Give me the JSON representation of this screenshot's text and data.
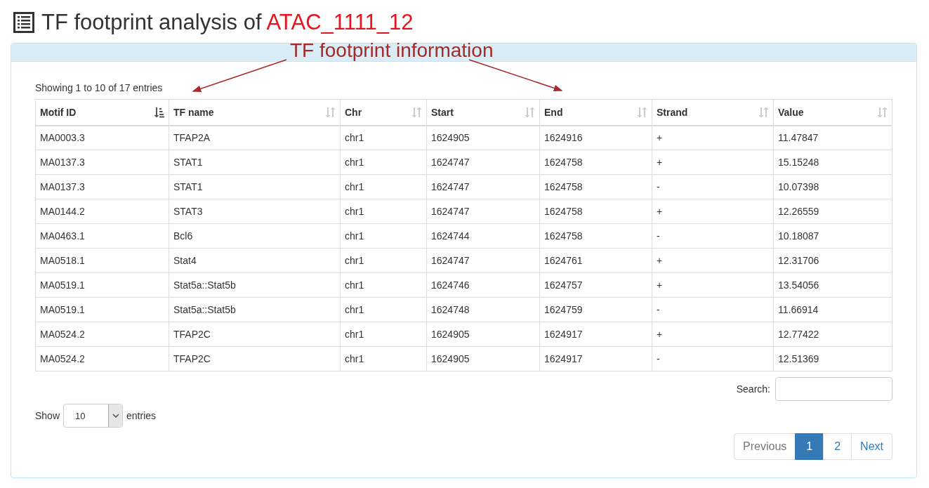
{
  "title": {
    "text": "TF footprint analysis of ",
    "sample": "ATAC_1111_12"
  },
  "annotation": {
    "label": "TF footprint information"
  },
  "table": {
    "info": "Showing 1 to 10 of 17 entries",
    "columns": [
      {
        "label": "Motif ID",
        "sorted": true
      },
      {
        "label": "TF name",
        "sorted": false
      },
      {
        "label": "Chr",
        "sorted": false
      },
      {
        "label": "Start",
        "sorted": false
      },
      {
        "label": "End",
        "sorted": false
      },
      {
        "label": "Strand",
        "sorted": false
      },
      {
        "label": "Value",
        "sorted": false
      }
    ],
    "rows": [
      [
        "MA0003.3",
        "TFAP2A",
        "chr1",
        "1624905",
        "1624916",
        "+",
        "11.47847"
      ],
      [
        "MA0137.3",
        "STAT1",
        "chr1",
        "1624747",
        "1624758",
        "+",
        "15.15248"
      ],
      [
        "MA0137.3",
        "STAT1",
        "chr1",
        "1624747",
        "1624758",
        "-",
        "10.07398"
      ],
      [
        "MA0144.2",
        "STAT3",
        "chr1",
        "1624747",
        "1624758",
        "+",
        "12.26559"
      ],
      [
        "MA0463.1",
        "Bcl6",
        "chr1",
        "1624744",
        "1624758",
        "-",
        "10.18087"
      ],
      [
        "MA0518.1",
        "Stat4",
        "chr1",
        "1624747",
        "1624761",
        "+",
        "12.31706"
      ],
      [
        "MA0519.1",
        "Stat5a::Stat5b",
        "chr1",
        "1624746",
        "1624757",
        "+",
        "13.54056"
      ],
      [
        "MA0519.1",
        "Stat5a::Stat5b",
        "chr1",
        "1624748",
        "1624759",
        "-",
        "11.66914"
      ],
      [
        "MA0524.2",
        "TFAP2C",
        "chr1",
        "1624905",
        "1624917",
        "+",
        "12.77422"
      ],
      [
        "MA0524.2",
        "TFAP2C",
        "chr1",
        "1624905",
        "1624917",
        "-",
        "12.51369"
      ]
    ]
  },
  "search": {
    "label": "Search:"
  },
  "length": {
    "show": "Show",
    "value": "10",
    "entries": "entries"
  },
  "pagination": [
    {
      "label": "Previous",
      "kind": "nav",
      "selected": false
    },
    {
      "label": "1",
      "kind": "page",
      "selected": true
    },
    {
      "label": "2",
      "kind": "page",
      "selected": false
    },
    {
      "label": "Next",
      "kind": "nav",
      "selected": false
    }
  ]
}
